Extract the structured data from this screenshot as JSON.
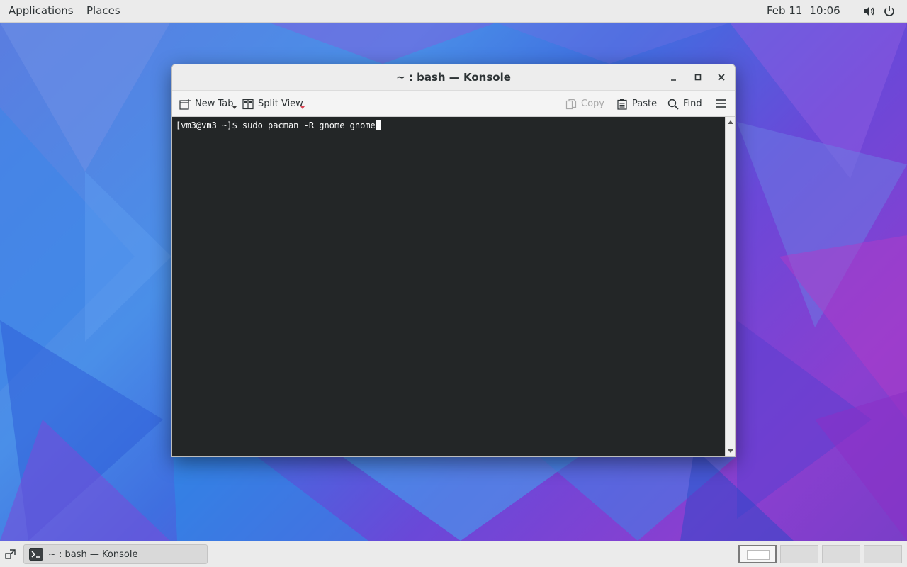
{
  "topbar": {
    "applications": "Applications",
    "places": "Places",
    "date": "Feb 11",
    "time": "10:06",
    "volume_icon": "volume-icon",
    "power_icon": "power-icon"
  },
  "window": {
    "title": "~ : bash — Konsole",
    "controls": [
      "minimize-icon",
      "maximize-icon",
      "close-icon"
    ]
  },
  "toolbar": {
    "new_tab": "New Tab",
    "split_view": "Split View",
    "copy": "Copy",
    "paste": "Paste",
    "find": "Find",
    "menu_icon": "hamburger-menu-icon"
  },
  "terminal": {
    "prompt": "[vm3@vm3 ~]$ ",
    "command": "sudo pacman -R gnome gnome"
  },
  "taskbar": {
    "task_label": "~ : bash — Konsole",
    "workspaces": [
      "workspace-1",
      "workspace-2",
      "workspace-3",
      "workspace-4"
    ],
    "active_workspace": 1
  },
  "colors": {
    "terminal_bg": "#232627",
    "terminal_fg": "#fcfcfc",
    "panel_bg": "#ebebeb"
  }
}
